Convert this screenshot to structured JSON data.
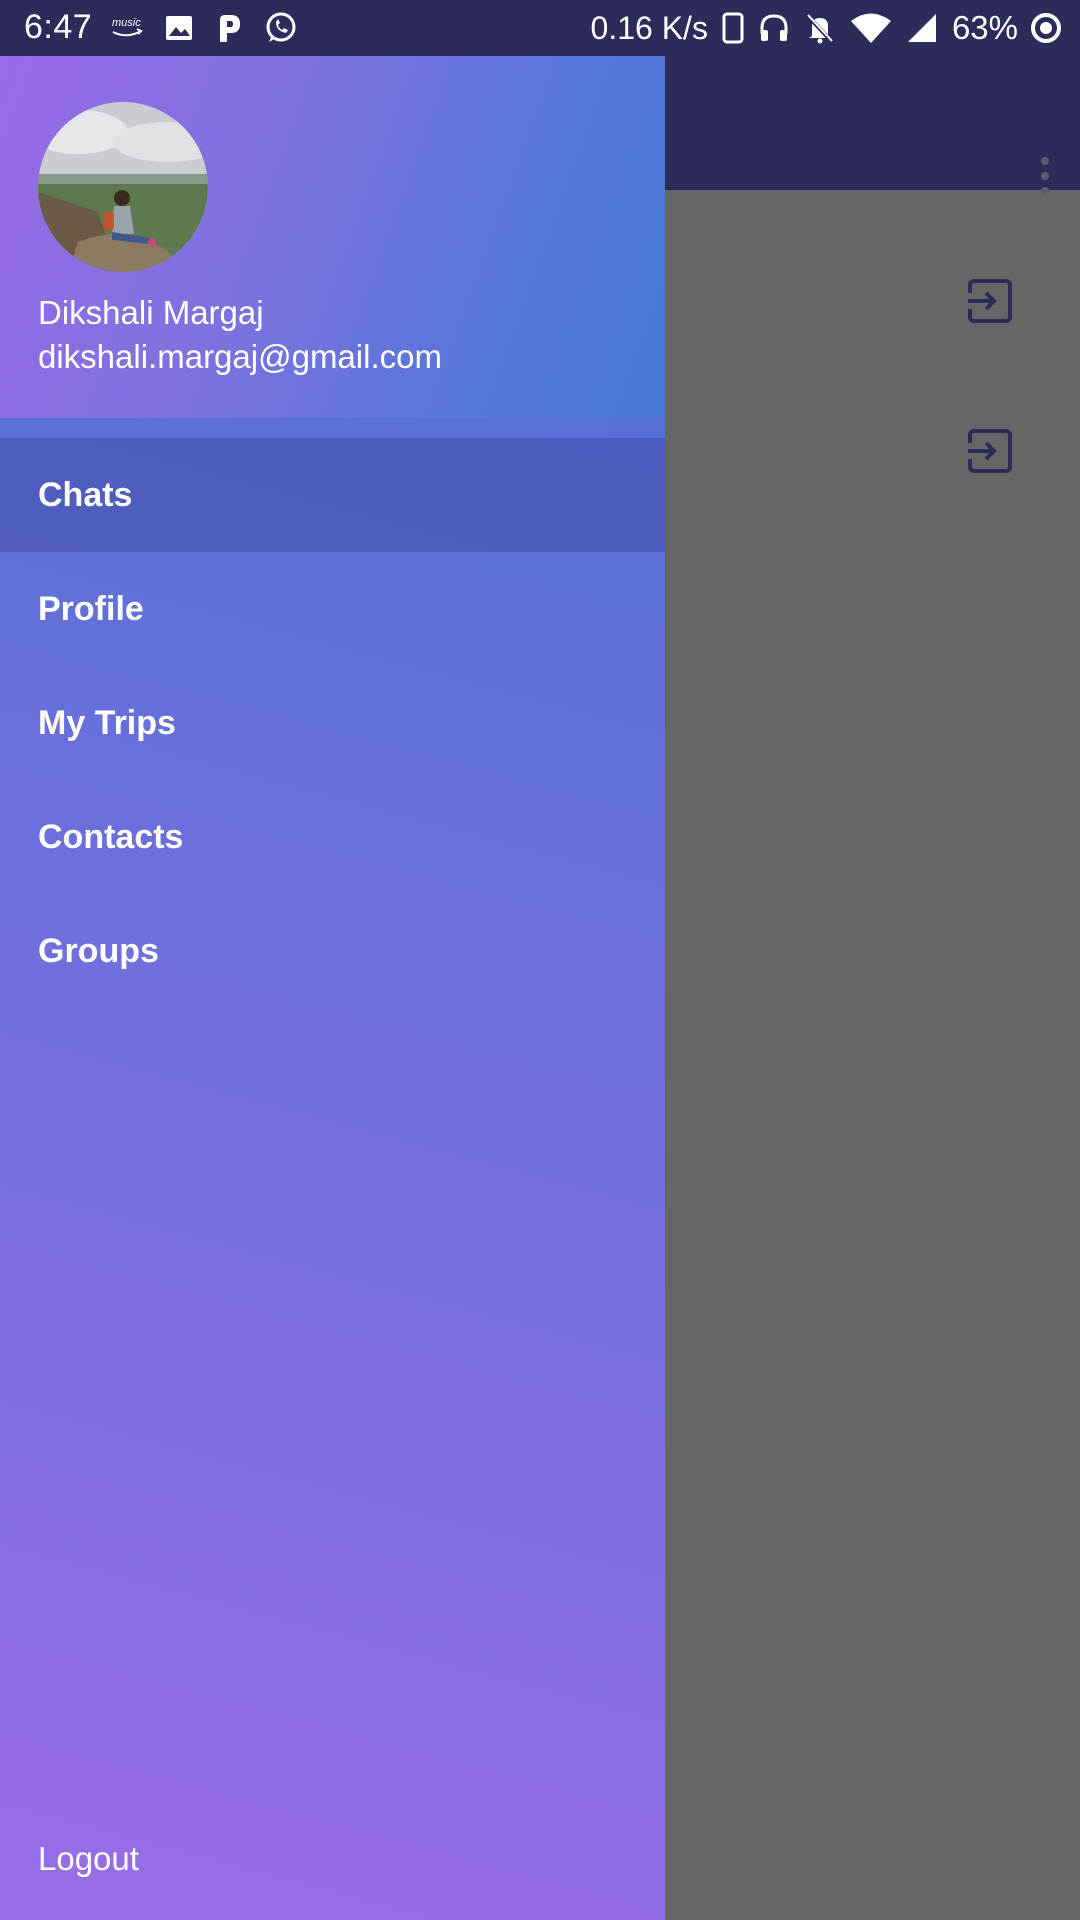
{
  "status_bar": {
    "time": "6:47",
    "music_label": "music",
    "net_speed": "0.16 K/s",
    "battery": "63%",
    "left_icons": [
      "amazon-music-icon",
      "image-icon",
      "paytm-icon",
      "whatsapp-icon"
    ],
    "right_icons": [
      "phone-icon",
      "headphones-icon",
      "notifications-off-icon",
      "wifi-icon",
      "signal-icon",
      "battery-saver-icon"
    ]
  },
  "drawer": {
    "user": {
      "name": "Dikshali Margaj",
      "email": "dikshali.margaj@gmail.com"
    },
    "menu": [
      {
        "label": "Chats",
        "active": true
      },
      {
        "label": "Profile",
        "active": false
      },
      {
        "label": "My Trips",
        "active": false
      },
      {
        "label": "Contacts",
        "active": false
      },
      {
        "label": "Groups",
        "active": false
      }
    ],
    "logout_label": "Logout"
  },
  "colors": {
    "status_bar": "#2c2b5a",
    "toolbar": "#2c2b5a",
    "scrim": "#666666",
    "drawer_top": "#4a6fd6",
    "drawer_bottom": "#9a6de6",
    "active_item": "#4f62b8"
  }
}
